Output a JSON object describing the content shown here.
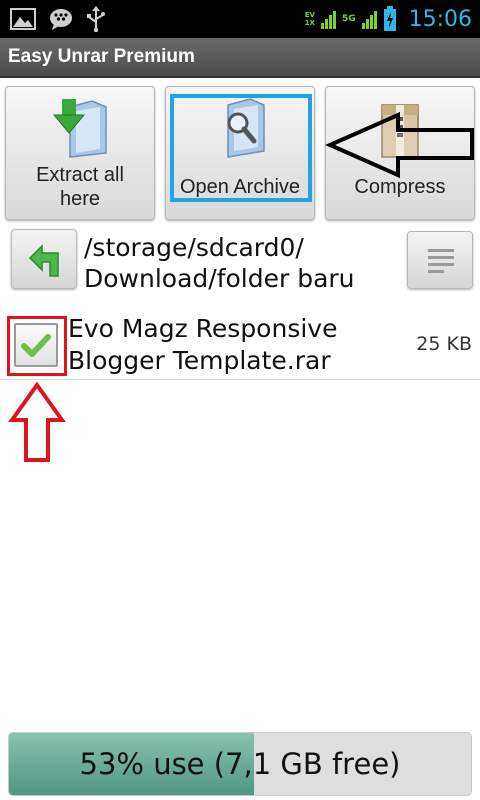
{
  "status_bar": {
    "time": "15:06",
    "network_top": "EV",
    "network_bottom": "1X",
    "signal_label": "5G",
    "icons": [
      "gallery-icon",
      "bbm-icon",
      "usb-icon",
      "signal-icon",
      "battery-icon"
    ]
  },
  "app": {
    "title": "Easy Unrar Premium"
  },
  "toolbar": {
    "extract_label_line1": "Extract all",
    "extract_label_line2": "here",
    "open_label": "Open Archive",
    "compress_label": "Compress"
  },
  "path": {
    "line1": "/storage/sdcard0/",
    "line2": "Download/folder baru"
  },
  "files": [
    {
      "name_line1": "Evo Magz Responsive",
      "name_line2": "Blogger Template.rar",
      "size": "25 KB",
      "checked": true
    }
  ],
  "storage": {
    "text": "53% use (7,1 GB free)",
    "used_fraction": 0.53
  },
  "colors": {
    "highlight_blue": "#1fa4e6",
    "annotation_red": "#e0141e",
    "status_accent": "#33b5e5",
    "storage_fill": "#4f9683"
  }
}
